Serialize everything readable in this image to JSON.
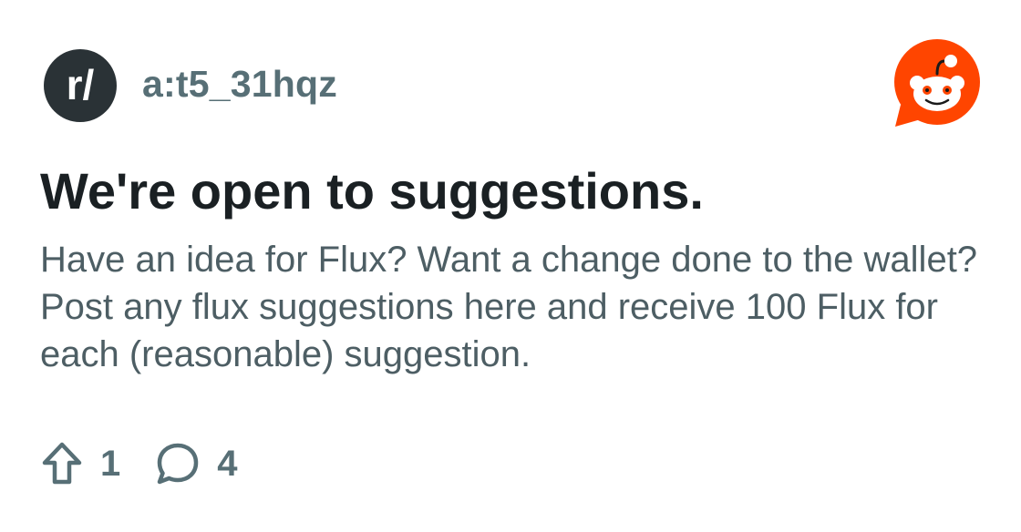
{
  "subreddit": {
    "name": "a:t5_31hqz",
    "avatar_icon": "subreddit-r-slash-icon",
    "avatar_glyph": "r/"
  },
  "brand": {
    "icon": "reddit-snoo-logo",
    "color": "#ff4500"
  },
  "post": {
    "title": "We're open to suggestions.",
    "body": "Have an idea for Flux? Want a change done to the wallet? Post any flux suggestions here and receive 100 Flux for each (reasonable) suggestion."
  },
  "stats": {
    "upvotes": "1",
    "upvote_icon": "upvote-arrow-icon",
    "comments": "4",
    "comment_icon": "comment-bubble-icon"
  },
  "colors": {
    "avatar_bg": "#2a3236",
    "muted_text": "#576f76",
    "title_text": "#1a2023",
    "body_text": "#4d5e64"
  }
}
